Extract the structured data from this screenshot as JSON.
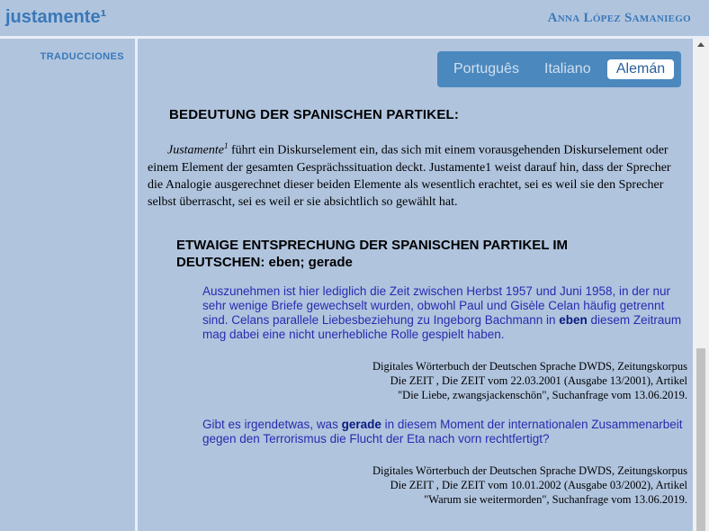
{
  "header": {
    "title": "justamente¹",
    "author": "Anna López Samaniego"
  },
  "sidebar": {
    "items": [
      {
        "label": "TRADUCCIONES"
      }
    ]
  },
  "language_tabs": [
    {
      "label": "Português",
      "active": false
    },
    {
      "label": "Italiano",
      "active": false
    },
    {
      "label": "Alemán",
      "active": true
    }
  ],
  "content": {
    "heading": "BEDEUTUNG DER SPANISCHEN PARTIKEL:",
    "paragraph": {
      "term": "Justamente",
      "sup": "1",
      "text": " führt ein Diskurselement ein, das sich mit einem vorausgehenden Diskurselement oder einem Element der gesamten Gesprächssituation deckt. Justamente1 weist darauf hin, dass der Sprecher die Analogie ausgerechnet dieser beiden Elemente als wesentlich erachtet, sei es weil sie den Sprecher selbst überrascht, sei es weil er sie absichtlich so gewählt hat."
    },
    "subheading": "ETWAIGE ENTSPRECHUNG DER SPANISCHEN PARTIKEL IM DEUTSCHEN: eben; gerade",
    "examples": [
      {
        "before": "Auszunehmen ist hier lediglich die Zeit zwischen Herbst 1957 und Juni 1958, in der nur sehr wenige Briefe gewechselt wurden, obwohl Paul und Gisèle Celan häufig getrennt sind. Celans parallele Liebesbeziehung zu Ingeborg Bachmann in ",
        "keyword": "eben",
        "after": " diesem Zeitraum mag dabei eine nicht unerhebliche Rolle gespielt haben.",
        "source": [
          "Digitales Wörterbuch der Deutschen Sprache DWDS, Zeitungskorpus",
          "Die ZEIT , Die ZEIT vom 22.03.2001 (Ausgabe 13/2001), Artikel",
          "\"Die Liebe, zwangsjackenschön\", Suchanfrage vom 13.06.2019."
        ]
      },
      {
        "before": "Gibt es irgendetwas, was ",
        "keyword": "gerade",
        "after": " in diesem Moment der internationalen Zusammenarbeit gegen den Terrorismus die Flucht der Eta nach vorn rechtfertigt?",
        "source": [
          "Digitales Wörterbuch der Deutschen Sprache DWDS, Zeitungskorpus",
          "Die ZEIT , Die ZEIT vom 10.01.2002 (Ausgabe 03/2002), Artikel",
          "\"Warum sie weitermorden\", Suchanfrage vom 13.06.2019."
        ]
      }
    ]
  }
}
